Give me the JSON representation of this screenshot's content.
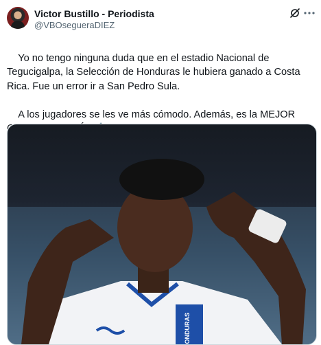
{
  "author": {
    "display_name": "Victor Bustillo - Periodista",
    "handle": "@VBOsegueraDIEZ"
  },
  "icons": {
    "avatar": "user-avatar",
    "grok": "grok-icon",
    "more": "more-options-icon"
  },
  "tweet": {
    "paragraph_1": "Yo no tengo ninguna duda que en el estadio Nacional de Tegucigalpa, la Selección de Honduras le hubiera ganado a Costa Rica. Fue un error ir a San Pedro Sula.",
    "paragraph_2": "A los jugadores se les ve más cómodo. Además, es la MEJOR CANCHA DE PAÍS.✍️"
  },
  "media": {
    "kind": "photo",
    "jersey_text": "HONDURAS"
  },
  "colors": {
    "text": "#0f1419",
    "secondary_text": "#536471",
    "border": "#cfd9de",
    "jersey_blue": "#1e4fa8"
  }
}
